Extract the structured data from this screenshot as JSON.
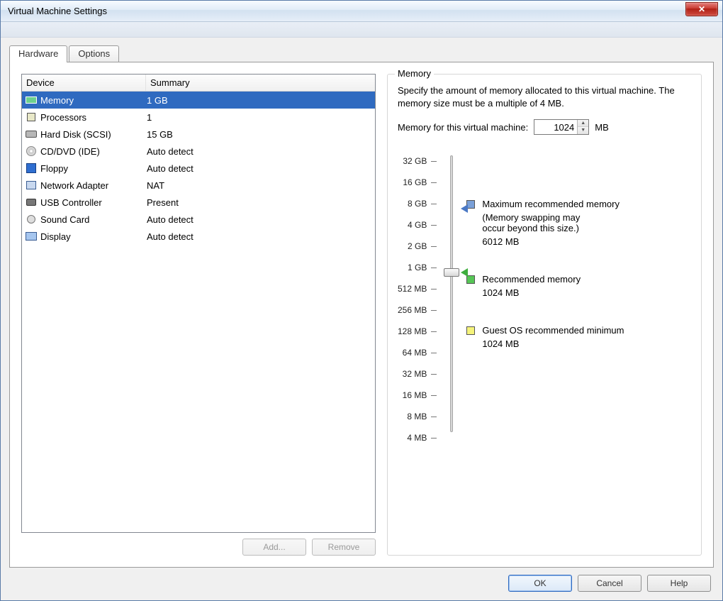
{
  "window": {
    "title": "Virtual Machine Settings"
  },
  "tabs": {
    "hardware": "Hardware",
    "options": "Options"
  },
  "device_table": {
    "col_device": "Device",
    "col_summary": "Summary",
    "rows": [
      {
        "name": "Memory",
        "summary": "1 GB",
        "icon": "ram",
        "selected": true
      },
      {
        "name": "Processors",
        "summary": "1",
        "icon": "cpu",
        "selected": false
      },
      {
        "name": "Hard Disk (SCSI)",
        "summary": "15 GB",
        "icon": "hdd",
        "selected": false
      },
      {
        "name": "CD/DVD (IDE)",
        "summary": "Auto detect",
        "icon": "cd",
        "selected": false
      },
      {
        "name": "Floppy",
        "summary": "Auto detect",
        "icon": "floppy",
        "selected": false
      },
      {
        "name": "Network Adapter",
        "summary": "NAT",
        "icon": "net",
        "selected": false
      },
      {
        "name": "USB Controller",
        "summary": "Present",
        "icon": "usb",
        "selected": false
      },
      {
        "name": "Sound Card",
        "summary": "Auto detect",
        "icon": "sound",
        "selected": false
      },
      {
        "name": "Display",
        "summary": "Auto detect",
        "icon": "display",
        "selected": false
      }
    ]
  },
  "left_buttons": {
    "add": "Add...",
    "remove": "Remove"
  },
  "memory_panel": {
    "legend": "Memory",
    "description": "Specify the amount of memory allocated to this virtual machine. The memory size must be a multiple of 4 MB.",
    "input_label": "Memory for this virtual machine:",
    "input_value": "1024",
    "unit": "MB",
    "ticks": [
      "32 GB",
      "16 GB",
      "8 GB",
      "4 GB",
      "2 GB",
      "1 GB",
      "512 MB",
      "256 MB",
      "128 MB",
      "64 MB",
      "32 MB",
      "16 MB",
      "8 MB",
      "4 MB"
    ],
    "slider_index": 5,
    "marker_blue_index": 2,
    "marker_green_index": 5,
    "legend_items": {
      "max": {
        "title": "Maximum recommended memory",
        "sub1": "(Memory swapping may",
        "sub2": "occur beyond this size.)",
        "value": "6012 MB"
      },
      "rec": {
        "title": "Recommended memory",
        "value": "1024 MB"
      },
      "min": {
        "title": "Guest OS recommended minimum",
        "value": "1024 MB"
      }
    }
  },
  "dialog_buttons": {
    "ok": "OK",
    "cancel": "Cancel",
    "help": "Help"
  }
}
